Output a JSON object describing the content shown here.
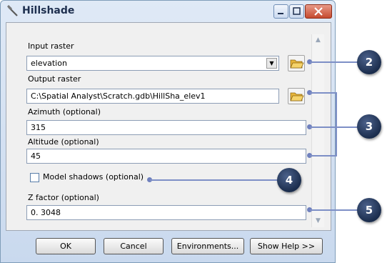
{
  "window": {
    "title": "Hillshade"
  },
  "form": {
    "input_raster_label": "Input raster",
    "input_raster_value": "elevation",
    "output_raster_label": "Output raster",
    "output_raster_value": "C:\\Spatial  Analyst\\Scratch.gdb\\HillSha_elev1",
    "azimuth_label": "Azimuth (optional)",
    "azimuth_value": "315",
    "altitude_label": "Altitude (optional)",
    "altitude_value": "45",
    "model_shadows_label": "Model shadows (optional)",
    "model_shadows_checked": false,
    "zfactor_label": "Z factor (optional)",
    "zfactor_value": "0. 3048"
  },
  "buttons": {
    "ok": "OK",
    "cancel": "Cancel",
    "environments": "Environments...",
    "show_help": "Show Help >>"
  },
  "callouts": [
    "2",
    "3",
    "4",
    "5"
  ],
  "icons": {
    "title": "hammer-icon",
    "browse": "folder-open-icon"
  },
  "colors": {
    "callout_bg": "#22355a",
    "leader_line": "#7d8fc6"
  }
}
